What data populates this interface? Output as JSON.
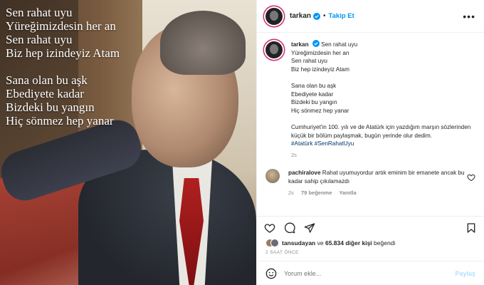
{
  "media": {
    "verse_lines_1": [
      "Sen rahat uyu",
      "Yüreğimizdesin her an",
      "Sen rahat uyu",
      "Biz hep izindeyiz Atam"
    ],
    "verse_lines_2": [
      "Sana olan bu aşk",
      "Ebediyete kadar",
      "Bizdeki bu yangın",
      "Hiç sönmez hep yanar"
    ]
  },
  "header": {
    "username": "tarkan",
    "separator": "•",
    "follow_label": "Takip Et",
    "more_label": "•••"
  },
  "caption": {
    "username": "tarkan",
    "first_line": "Sen rahat uyu",
    "lines_1": [
      "Yüreğimizdesin her an",
      "Sen rahat uyu",
      "Biz hep izindeyiz Atam"
    ],
    "lines_2": [
      "Sana olan bu aşk",
      "Ebediyete kadar",
      "Bizdeki bu yangın",
      "Hiç sönmez hep yanar"
    ],
    "paragraph": "Cumhuriyet'in 100. yılı ve de Atatürk için yazdığım marşın sözlerinden küçük bir bölüm paylaşmak, bugün yerinde olur dedim.",
    "hashtags": "#Atatürk #SenRahatUyu",
    "age": "2s"
  },
  "comment": {
    "username": "pachiralove",
    "text": "Rahat uyumuyordur artık eminim bir emanete ancak bu kadar sahip çıkılamazdı",
    "age": "2s",
    "likes": "79 beğenme",
    "reply": "Yanıtla"
  },
  "likes": {
    "user": "tansudayan",
    "connector": "ve",
    "others": "65.834 diğer kişi",
    "suffix": "beğendi"
  },
  "timestamp": "2 SAAT ÖNCE",
  "composer": {
    "placeholder": "Yorum ekle...",
    "post_label": "Paylaş"
  }
}
